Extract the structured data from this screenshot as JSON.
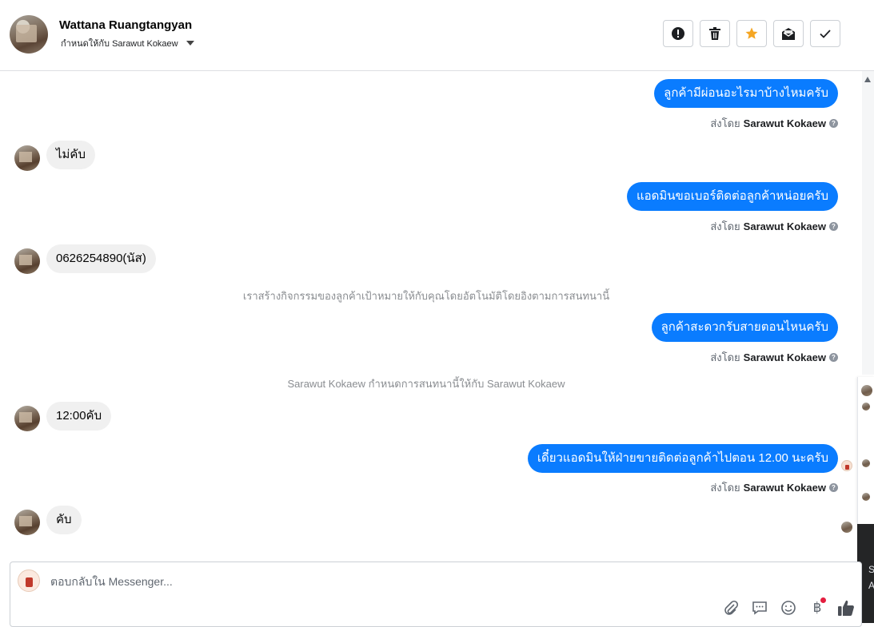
{
  "header": {
    "contact_name": "Wattana Ruangtangyan",
    "assigned_label": "กำหนดให้กับ Sarawut Kokaew",
    "tools": [
      {
        "name": "spam",
        "icon": "alert-circle-icon"
      },
      {
        "name": "delete",
        "icon": "trash-icon"
      },
      {
        "name": "star",
        "icon": "star-icon",
        "color": "#f5a623"
      },
      {
        "name": "mark-unread",
        "icon": "envelope-icon"
      },
      {
        "name": "done",
        "icon": "check-icon"
      }
    ]
  },
  "messages": {
    "m1": {
      "text": "ลูกค้ามีผ่อนอะไรมาบ้างไหมครับ",
      "sent_by_prefix": "ส่งโดย",
      "sent_by_name": "Sarawut Kokaew"
    },
    "m2": {
      "text": "ไม่คับ"
    },
    "m3": {
      "text": "แอดมินขอเบอร์ติดต่อลูกค้าหน่อยครับ",
      "sent_by_prefix": "ส่งโดย",
      "sent_by_name": "Sarawut Kokaew"
    },
    "m4": {
      "text": "0626254890(นัส)"
    },
    "sys1": "เราสร้างกิจกรรมของลูกค้าเป้าหมายให้กับคุณโดยอัตโนมัติโดยอิงตามการสนทนานี้",
    "m5": {
      "text": "ลูกค้าสะดวกรับสายตอนไหนครับ",
      "sent_by_prefix": "ส่งโดย",
      "sent_by_name": "Sarawut Kokaew"
    },
    "sys2": "Sarawut Kokaew กำหนดการสนทนานี้ให้กับ Sarawut Kokaew",
    "m6": {
      "text": "12:00คับ"
    },
    "m7": {
      "text": "เดี๋ยวแอดมินให้ฝ่ายขายติดต่อลูกค้าไปตอน 12.00 นะครับ",
      "sent_by_prefix": "ส่งโดย",
      "sent_by_name": "Sarawut Kokaew"
    },
    "m8": {
      "text": "คับ"
    }
  },
  "composer": {
    "placeholder": "ตอบกลับใน Messenger...",
    "tools": [
      "paperclip-icon",
      "saved-reply-icon",
      "emoji-icon",
      "baht-payment-icon",
      "thumbs-up-icon"
    ]
  },
  "side_panel_text": [
    "S",
    "A"
  ],
  "colors": {
    "outgoing": "#0a7cff",
    "incoming": "#f0f0f0",
    "star": "#f5a623"
  }
}
